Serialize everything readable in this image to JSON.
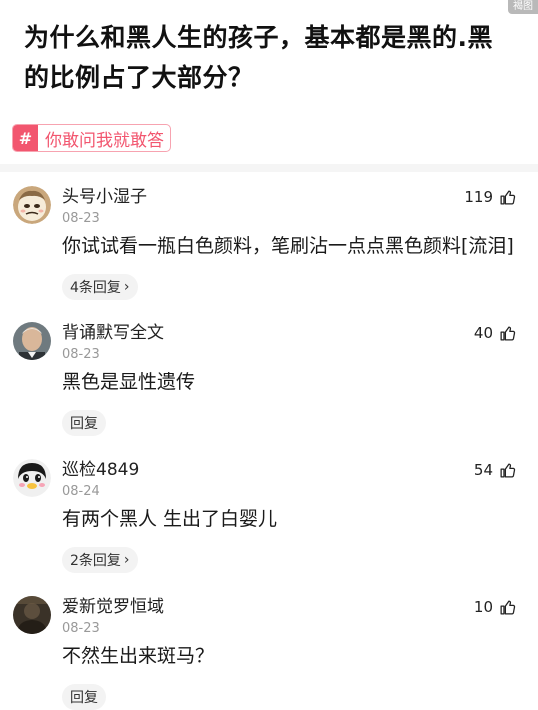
{
  "corner_badge": "褐图",
  "question": {
    "title": "为什么和黑人生的孩子，基本都是黑的.黑的比例占了大部分？"
  },
  "topic": {
    "hash_symbol": "#",
    "label": "你敢问我就敢答"
  },
  "colors": {
    "accent": "#f2566f",
    "accent_border": "#f7a3b0",
    "muted": "#999999",
    "reply_bg": "#f3f3f3",
    "divider": "#f5f5f5"
  },
  "comments": [
    {
      "username": "头号小湿子",
      "date": "08-23",
      "likes": "119",
      "text": "你试试看一瓶白色颜料，笔刷沾一点点黑色颜料[流泪]",
      "reply_label": "4条回复",
      "reply_chevron": "›",
      "avatar_icon": "cartoon-face-avatar"
    },
    {
      "username": "背诵默写全文",
      "date": "08-23",
      "likes": "40",
      "text": "黑色是显性遗传",
      "reply_label": "回复",
      "reply_chevron": "",
      "avatar_icon": "man-portrait-avatar"
    },
    {
      "username": "巡检4849",
      "date": "08-24",
      "likes": "54",
      "text": "有两个黑人 生出了白婴儿",
      "reply_label": "2条回复",
      "reply_chevron": "›",
      "avatar_icon": "penguin-cartoon-avatar"
    },
    {
      "username": "爱新觉罗恒域",
      "date": "08-23",
      "likes": "10",
      "text": "不然生出来斑马？",
      "reply_label": "回复",
      "reply_chevron": "",
      "avatar_icon": "dark-photo-avatar"
    }
  ]
}
